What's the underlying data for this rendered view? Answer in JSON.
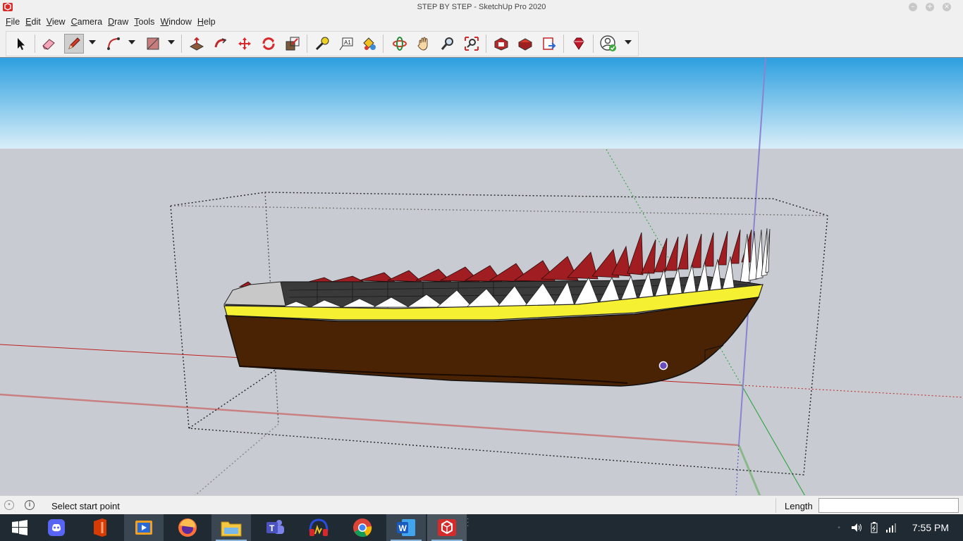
{
  "window": {
    "title": "STEP BY STEP - SketchUp Pro 2020"
  },
  "menu": {
    "items": [
      "File",
      "Edit",
      "View",
      "Camera",
      "Draw",
      "Tools",
      "Window",
      "Help"
    ]
  },
  "toolbar": {
    "tools": [
      "select",
      "eraser",
      "line",
      "arc",
      "rectangle",
      "push-pull",
      "follow-me",
      "move",
      "rotate",
      "scale",
      "tape-measure",
      "text",
      "paint-bucket",
      "orbit",
      "pan",
      "zoom",
      "zoom-extents",
      "3d-warehouse",
      "extension-warehouse",
      "send-to-layout",
      "extension-manager",
      "account"
    ],
    "active_tool": "line"
  },
  "viewport": {
    "sky_top": "#2d9fe0",
    "sky_bottom": "#d8eef8",
    "ground": "#c8ccd2",
    "model": "pirate ship hull with teeth"
  },
  "status": {
    "message": "Select start point"
  },
  "measurements": {
    "label": "Length",
    "value": ""
  },
  "taskbar": {
    "apps": [
      "windows-start",
      "discord",
      "office",
      "video-player",
      "firefox",
      "file-explorer",
      "teams",
      "audio-app",
      "chrome",
      "word",
      "sketchup"
    ],
    "active_app": "sketchup",
    "time": "7:55 PM"
  },
  "colors": {
    "hull": "#4a2204",
    "stripe": "#f5f032",
    "teeth": "#ffffff",
    "red_teeth": "#a01e22",
    "deck": "#3a3a3a"
  }
}
